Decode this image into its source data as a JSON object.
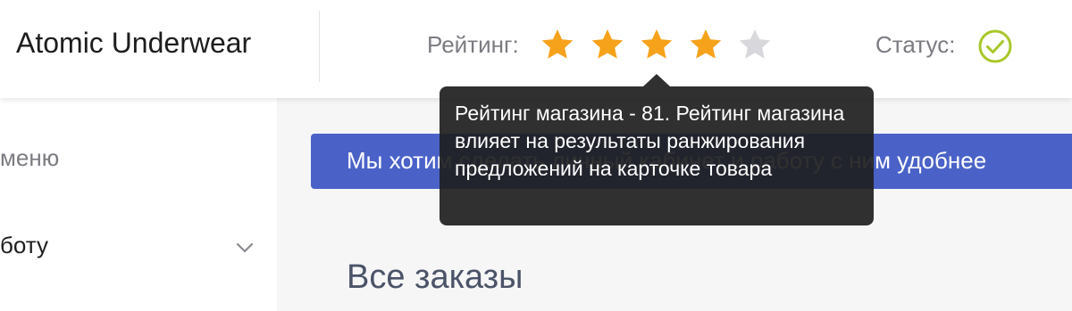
{
  "header": {
    "shop_name": "Atomic Underwear",
    "rating_label": "Рейтинг:",
    "rating_stars": 4,
    "rating_max": 5,
    "status_label": "Статус:",
    "status_icon": "check-circle-icon"
  },
  "tooltip": {
    "text": "Рейтинг магазина - 81. Рейтинг магазина влияет на результаты ранжирования предложений на карточке товара"
  },
  "sidebar": {
    "items": [
      {
        "label": "меню"
      },
      {
        "label": "боту",
        "icon": "chevron-down-icon"
      }
    ]
  },
  "banner": {
    "text": "Мы хотим сделать личный кабинет и работу с ним удобнее"
  },
  "main": {
    "title": "Все заказы"
  },
  "colors": {
    "star_filled": "#f7a21b",
    "star_empty": "#d8d8dc",
    "status_ok": "#a8c72a",
    "banner_bg": "#4a62c8",
    "tooltip_bg": "#1e1e20"
  }
}
